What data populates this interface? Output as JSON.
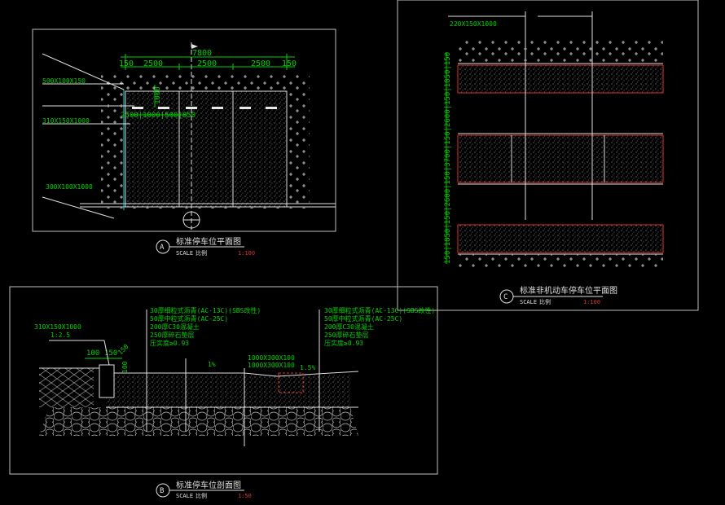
{
  "view_a": {
    "overall_dim": "7800",
    "dims_top": [
      "150",
      "2500",
      "2500",
      "2500",
      "150"
    ],
    "inner_dims": "2500|1000|500|850",
    "depth_dim": "1000",
    "labels": [
      "500X100X150",
      "310X150X1000",
      "300X100X1000"
    ],
    "title_letter": "A",
    "title": "标准停车位平面图",
    "scale_label": "SCALE",
    "scale_word": "比例",
    "scale_value": "1:100"
  },
  "view_b": {
    "left_callouts": [
      "310X150X1000",
      "1:2.5"
    ],
    "dims": [
      "100",
      "150",
      "100",
      "150"
    ],
    "slope_left": "1%",
    "slope_right": "1.5%",
    "layers_left": [
      "30厚细粒式沥青(AC-13C)(SBS改性)",
      "50厚中粒式沥青(AC-25C)",
      "200厚C30混凝土",
      "250厚碎石垫层",
      "压实度≥0.93"
    ],
    "layers_right": [
      "30厚细粒式沥青(AC-13C)(SBS改性)",
      "50厚中粒式沥青(AC-25C)",
      "200厚C30混凝土",
      "250厚碎石垫层",
      "压实度≥0.93"
    ],
    "mid_labels": [
      "1000X300X100",
      "1000X300X100"
    ],
    "title_letter": "B",
    "title": "标准停车位剖面图",
    "scale_label": "SCALE",
    "scale_word": "比例",
    "scale_value": "1:50"
  },
  "view_c": {
    "top_labels": [
      "220X150X1000"
    ],
    "vertical_dims": [
      "150",
      "1850",
      "150",
      "2600",
      "150",
      "3700",
      "150",
      "2600",
      "150",
      "1850",
      "150"
    ],
    "dims_combined": "150|1850|150|2600|150|3700|150|2600|150|1850|150",
    "title_letter": "C",
    "title": "标准非机动车停车位平面图",
    "scale_label": "SCALE",
    "scale_word": "比例",
    "scale_value": "1:100"
  },
  "colors": {
    "background": "#000000",
    "dimension": "#00d200",
    "line": "#e0e0e0",
    "accent": "#e03030",
    "frame": "#bfbfbf"
  }
}
